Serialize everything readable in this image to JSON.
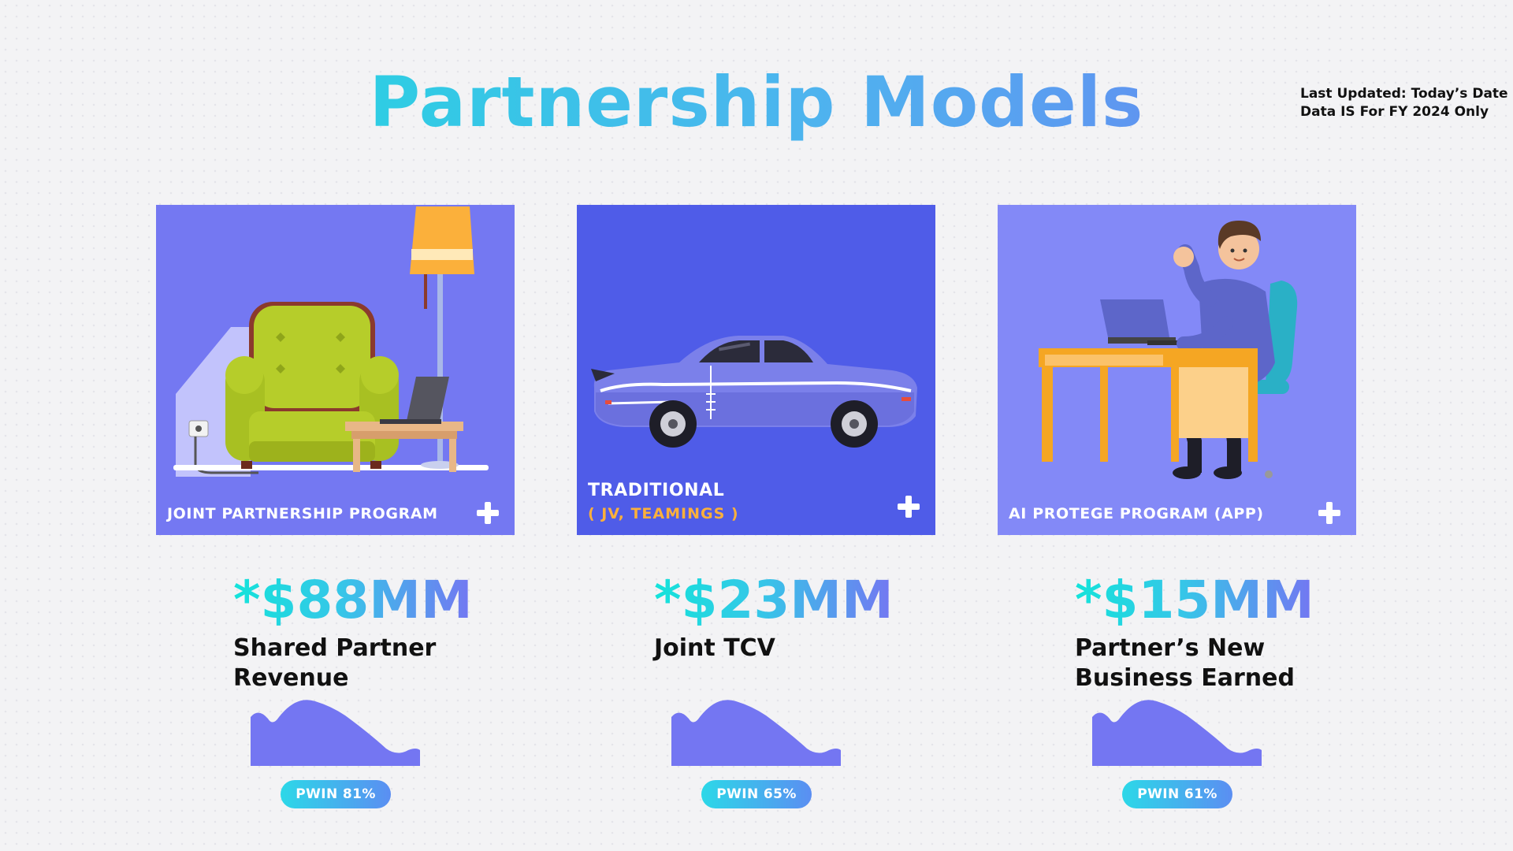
{
  "title": "Partnership Models",
  "meta": {
    "last_updated": "Last Updated: Today’s Date",
    "data_scope": "Data IS For FY 2024 Only"
  },
  "colors": {
    "card1_bg": "#7478f2",
    "card2_bg": "#4f5ce8",
    "card3_bg": "#8389f7",
    "accent_orange": "#fbb03b",
    "sparkline": "#7476f2"
  },
  "cards": [
    {
      "label": "JOINT PARTNERSHIP PROGRAM",
      "illustration": "armchair-lamp-laptop"
    },
    {
      "label": "TRADITIONAL",
      "sub_label": "( JV, TEAMINGS )",
      "illustration": "muscle-car"
    },
    {
      "label": "AI PROTEGE PROGRAM (APP)",
      "illustration": "person-at-desk-waving"
    }
  ],
  "stats": [
    {
      "amount": "*$88MM",
      "label_line1": "Shared Partner",
      "label_line2": "Revenue",
      "pwin": "PWIN 81%",
      "pwin_value": 81
    },
    {
      "amount": "*$23MM",
      "label_line1": "Joint TCV",
      "label_line2": "",
      "pwin": "PWIN 65%",
      "pwin_value": 65
    },
    {
      "amount": "*$15MM",
      "label_line1": "Partner’s New",
      "label_line2": "Business Earned",
      "pwin": "PWIN 61%",
      "pwin_value": 61
    }
  ],
  "icons": {
    "expand": "plus-icon",
    "sparkline": "area-sparkline"
  }
}
